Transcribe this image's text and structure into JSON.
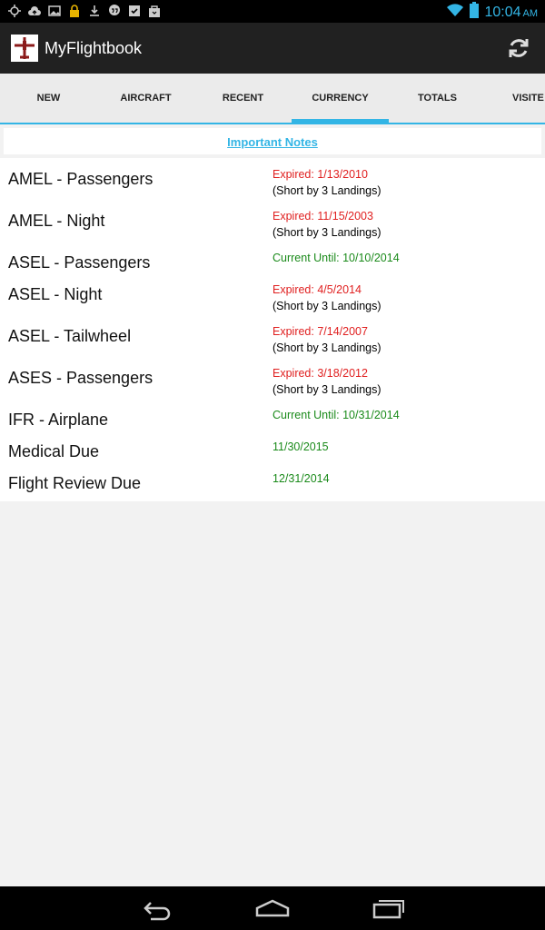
{
  "status_bar": {
    "time": "10:04",
    "ampm": "AM"
  },
  "app": {
    "title": "MyFlightbook"
  },
  "tabs": [
    {
      "label": "NEW"
    },
    {
      "label": "AIRCRAFT"
    },
    {
      "label": "RECENT"
    },
    {
      "label": "CURRENCY"
    },
    {
      "label": "TOTALS"
    },
    {
      "label": "VISITE"
    }
  ],
  "notes": {
    "link_text": "Important Notes"
  },
  "currency": [
    {
      "label": "AMEL - Passengers",
      "status": "Expired: 1/13/2010",
      "detail": "(Short by 3 Landings)"
    },
    {
      "label": "AMEL - Night",
      "status": "Expired: 11/15/2003",
      "detail": "(Short by 3 Landings)"
    },
    {
      "label": "ASEL - Passengers",
      "status": "Current Until: 10/10/2014",
      "detail": ""
    },
    {
      "label": "ASEL - Night",
      "status": "Expired: 4/5/2014",
      "detail": "(Short by 3 Landings)"
    },
    {
      "label": "ASEL - Tailwheel",
      "status": "Expired: 7/14/2007",
      "detail": "(Short by 3 Landings)"
    },
    {
      "label": "ASES - Passengers",
      "status": "Expired: 3/18/2012",
      "detail": "(Short by 3 Landings)"
    },
    {
      "label": "IFR - Airplane",
      "status": "Current Until: 10/31/2014",
      "detail": ""
    },
    {
      "label": "Medical Due",
      "status": "11/30/2015",
      "detail": ""
    },
    {
      "label": "Flight Review Due",
      "status": "12/31/2014",
      "detail": ""
    }
  ],
  "colors": {
    "expired": "#e02020",
    "current": "#1a8a1a",
    "accent": "#33b5e5"
  },
  "icons": {
    "status_left": [
      "gps-icon",
      "cloud-upload-icon",
      "image-icon",
      "lock-icon",
      "download-icon",
      "hangouts-icon",
      "checklist-icon",
      "bag-icon"
    ],
    "status_right": [
      "wifi-icon",
      "battery-icon"
    ],
    "nav": [
      "back-icon",
      "home-icon",
      "recent-apps-icon"
    ]
  }
}
